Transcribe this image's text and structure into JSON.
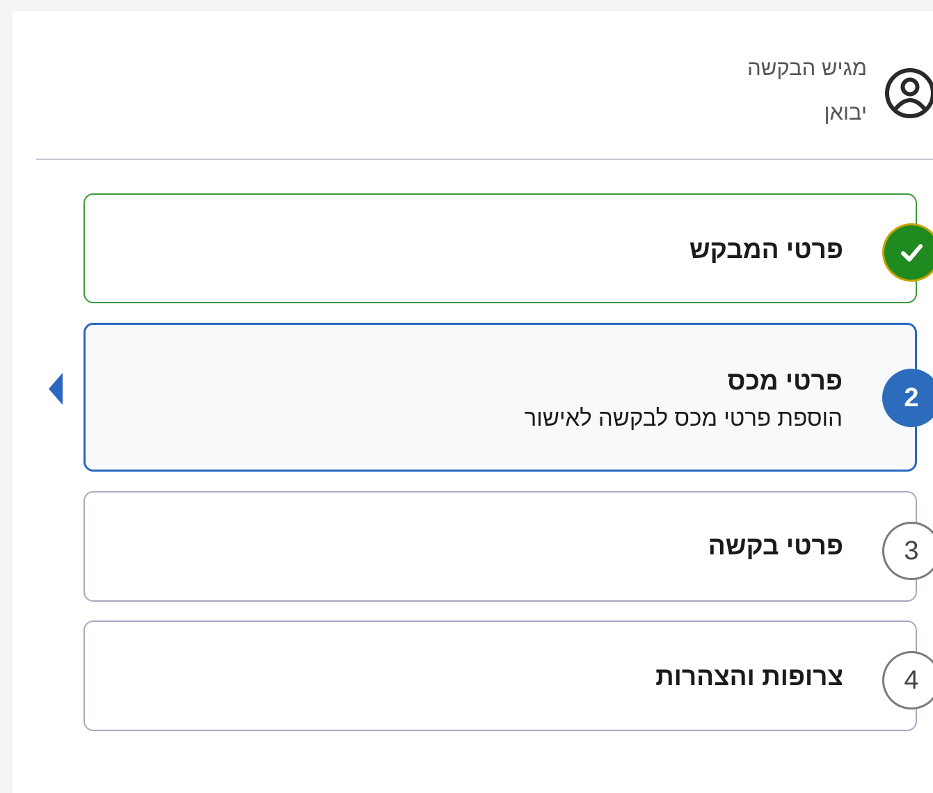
{
  "applicant": {
    "icon": "user-circle-icon",
    "label": "מגיש הבקשה",
    "value": "יבואן"
  },
  "steps": [
    {
      "number": "",
      "title": "פרטי המבקש",
      "subtitle": "",
      "status": "completed",
      "icon": "check-icon"
    },
    {
      "number": "2",
      "title": "פרטי מכס",
      "subtitle": "הוספת פרטי מכס לבקשה לאישור",
      "status": "active"
    },
    {
      "number": "3",
      "title": "פרטי בקשה",
      "subtitle": "",
      "status": "pending"
    },
    {
      "number": "4",
      "title": "צרופות והצהרות",
      "subtitle": "",
      "status": "pending"
    }
  ],
  "colors": {
    "completed": "#1f8a1f",
    "active": "#2d6cbc",
    "pending_border": "#7a7a7a",
    "divider": "#c6c8d6"
  }
}
